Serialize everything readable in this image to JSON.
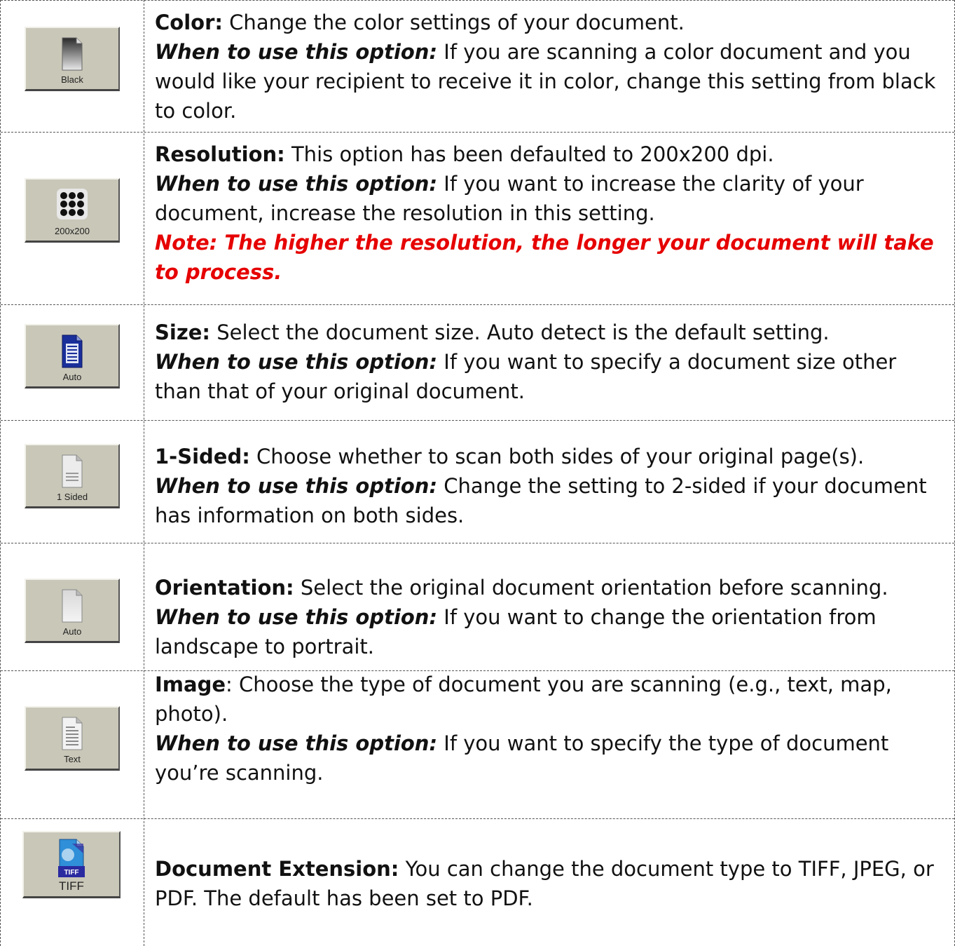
{
  "rows": [
    {
      "icon": "blank-page-icon",
      "button_label": "Black",
      "label": "Color:",
      "desc": " Change the color settings of your document.",
      "when_label": "When to use this option:",
      "when_text": " If you are scanning a color document and you would like your recipient to receive it in color, change this setting from black to color."
    },
    {
      "icon": "dot-grid-icon",
      "button_label": "200x200",
      "label": "Resolution:",
      "desc": " This option has been defaulted to 200x200 dpi.",
      "when_label": "When to use this option:",
      "when_text": " If you want to increase the clarity of your document, increase the resolution in this setting.",
      "note": "Note: The higher the resolution, the longer your document will take to process."
    },
    {
      "icon": "document-size-icon",
      "button_label": "Auto",
      "label": "Size:",
      "desc": " Select the document size. Auto detect is the default setting.",
      "when_label": "When to use this option:",
      "when_text": " If you want to specify a document size other than that of your original document."
    },
    {
      "icon": "one-sided-page-icon",
      "button_label": "1 Sided",
      "label": "1-Sided:",
      "desc": " Choose whether to scan both sides of your original page(s).",
      "when_label": "When to use this option:",
      "when_text": " Change the setting to 2-sided if your document has information on both sides."
    },
    {
      "icon": "orientation-page-icon",
      "button_label": "Auto",
      "label": "Orientation:",
      "desc": " Select the original document orientation before scanning.",
      "when_label": "When to use this option:",
      "when_text": " If you want to change the orientation from landscape to portrait."
    },
    {
      "icon": "text-page-icon",
      "button_label": "Text",
      "label": "Image",
      "desc": ": Choose the type of document you are scanning (e.g., text, map, photo).",
      "when_label": "When to use this option:",
      "when_text": " If you want to specify the type of document you’re scanning."
    },
    {
      "icon": "tiff-file-icon",
      "button_label": "TIFF",
      "icon_badge": "TIFF",
      "label": "Document Extension:",
      "desc": " You can change the document type to TIFF, JPEG, or PDF. The default has been set to PDF."
    }
  ]
}
